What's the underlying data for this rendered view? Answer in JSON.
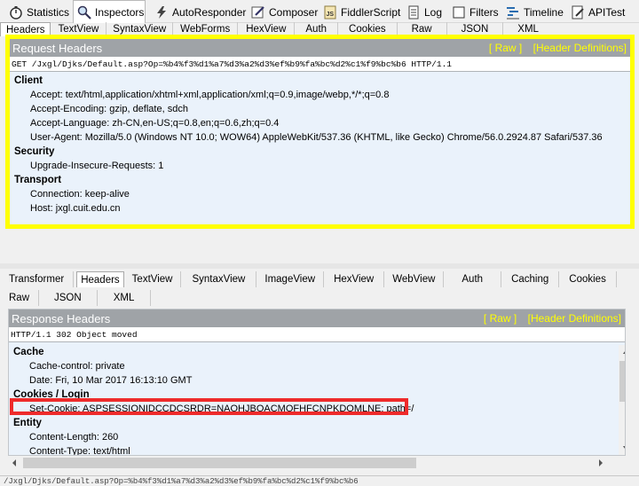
{
  "top_tabs": [
    {
      "label": "Statistics",
      "icon": "stopwatch-icon"
    },
    {
      "label": "Inspectors",
      "icon": "magnifier-icon",
      "active": true
    },
    {
      "label": "AutoResponder",
      "icon": "lightning-icon"
    },
    {
      "label": "Composer",
      "icon": "pencil-icon"
    },
    {
      "label": "FiddlerScript",
      "icon": "js-script-icon"
    },
    {
      "label": "Log",
      "icon": "log-icon"
    },
    {
      "label": "Filters",
      "icon": "checkbox-icon"
    },
    {
      "label": "Timeline",
      "icon": "timeline-icon"
    },
    {
      "label": "APITest",
      "icon": "edit-document-icon"
    }
  ],
  "request": {
    "tabs": [
      "Headers",
      "TextView",
      "SyntaxView",
      "WebForms",
      "HexView",
      "Auth",
      "Cookies",
      "Raw",
      "JSON",
      "XML"
    ],
    "active_tab": "Headers",
    "title": "Request Headers",
    "raw_link": "[ Raw ]",
    "defs_link": "[Header Definitions]",
    "request_line": "GET /Jxgl/Djks/Default.asp?Op=%b4%f3%d1%a7%d3%a2%d3%ef%b9%fa%bc%d2%c1%f9%bc%b6 HTTP/1.1",
    "groups": [
      {
        "name": "Client",
        "rows": [
          "Accept: text/html,application/xhtml+xml,application/xml;q=0.9,image/webp,*/*;q=0.8",
          "Accept-Encoding: gzip, deflate, sdch",
          "Accept-Language: zh-CN,en-US;q=0.8,en;q=0.6,zh;q=0.4",
          "User-Agent: Mozilla/5.0 (Windows NT 10.0; WOW64) AppleWebKit/537.36 (KHTML, like Gecko) Chrome/56.0.2924.87 Safari/537.36"
        ]
      },
      {
        "name": "Security",
        "rows": [
          "Upgrade-Insecure-Requests: 1"
        ]
      },
      {
        "name": "Transport",
        "rows": [
          "Connection: keep-alive",
          "Host: jxgl.cuit.edu.cn"
        ]
      }
    ]
  },
  "response": {
    "tabs_row1": [
      "Transformer",
      "Headers",
      "TextView",
      "SyntaxView",
      "ImageView",
      "HexView",
      "WebView",
      "Auth",
      "Caching",
      "Cookies"
    ],
    "tabs_row2": [
      "Raw",
      "JSON",
      "XML"
    ],
    "active_tab": "Headers",
    "title": "Response Headers",
    "raw_link": "[ Raw ]",
    "defs_link": "[Header Definitions]",
    "status_line": "HTTP/1.1 302 Object moved",
    "groups": [
      {
        "name": "Cache",
        "rows": [
          "Cache-control: private",
          "Date: Fri, 10 Mar 2017 16:13:10 GMT"
        ]
      },
      {
        "name": "Cookies / Login",
        "rows": [
          "Set-Cookie: ASPSESSIONIDCCDCSRDR=NAOHJBOACMOFHFCNPKDOMLNE; path=/"
        ]
      },
      {
        "name": "Entity",
        "rows": [
          "Content-Length: 260",
          "Content-Type: text/html"
        ]
      }
    ]
  },
  "status_bar": {
    "text": "/Jxgl/Djks/Default.asp?Op=%b4%f3%d1%a7%d3%a2%d3%ef%b9%fa%bc%d2%c1%f9%bc%b6"
  },
  "colors": {
    "highlight_yellow": "#ffff00",
    "highlight_red": "#ee2b2b",
    "header_bg": "#9fa3a7",
    "link_yellow": "#ffff00"
  }
}
